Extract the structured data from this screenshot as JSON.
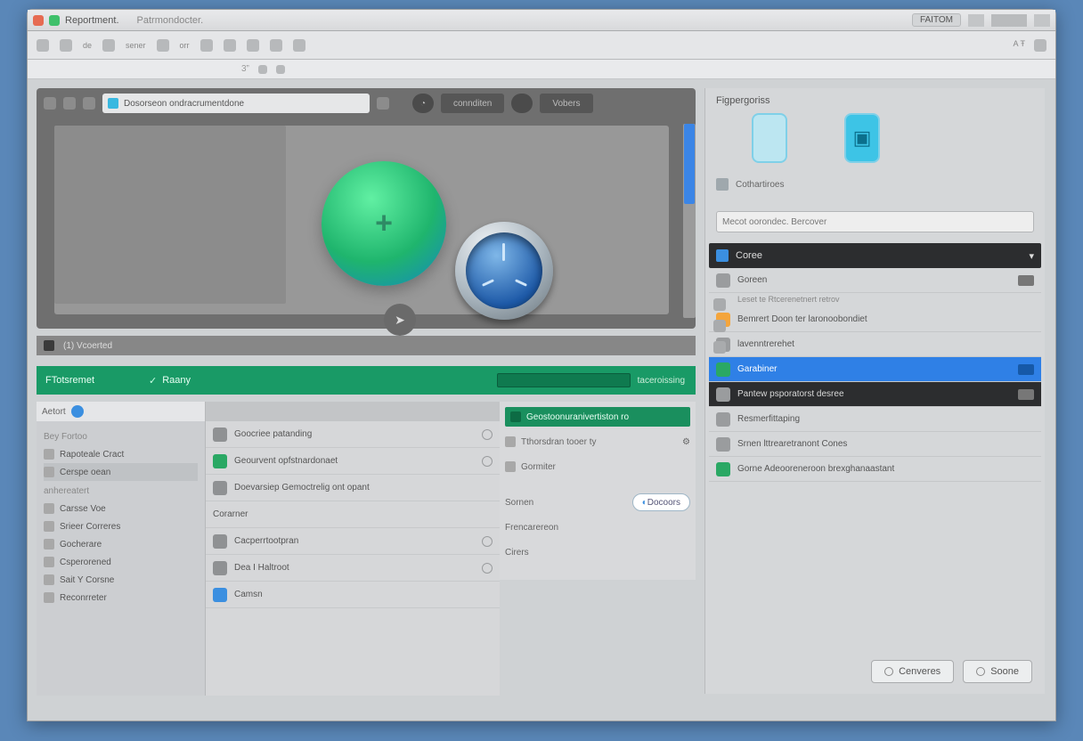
{
  "titlebar": {
    "title": "Reportment.",
    "subtitle": "Patrmondocter.",
    "badge": "FAITOM"
  },
  "iconrow": {
    "labels": [
      "",
      "de",
      "sener",
      "orr",
      "",
      "",
      "",
      "",
      ""
    ],
    "right_label": "A Ŧ"
  },
  "canvas": {
    "url_text": "Dosorseon ondracrumentdone",
    "btn_connect": "connditen",
    "btn_vobers": "Vobers",
    "footer_text": "(1)  Vcoerted"
  },
  "greenbar": {
    "left": "FTotsremet",
    "btn": "Raany",
    "right_text": "taceroissing"
  },
  "lowerleft": {
    "tab": "Aetort",
    "sections": {
      "a_head": "Bey Fortoo",
      "a_items": [
        "Rapoteale Cract",
        "Cerspe oean"
      ],
      "b_head": "anhereatert",
      "b_items": [
        "Carsse Voe",
        "Srieer Correres",
        "Gocherare",
        "Csperorened",
        "Sait Y Corsne",
        "Reconrreter"
      ]
    }
  },
  "lowermid": {
    "rows": [
      "Goocriee patanding",
      "Geourvent opfstnardonaet",
      "Doevarsiep Gemoctrelig ont opant",
      "Corarner",
      "Cacperrtootpran",
      "Dea I Haltroot",
      "Camsn"
    ]
  },
  "lowerright": {
    "header": "Geostoonuranivertiston ro",
    "line1": "Tthorsdran tooer ty",
    "line2": "Gormiter",
    "l1": "Sornen",
    "l2": "Frencarereon",
    "l3": "Cirers",
    "pill": "Docoors"
  },
  "rightpanel": {
    "title": "Figpergoriss",
    "row_label": "Cothartiroes",
    "search_placeholder": "Mecot oorondec. Bercover",
    "dark_label": "Coree",
    "group_head": "Goreen",
    "group_sub": "Leset te Rtcerenetnert retrov",
    "items": [
      "Bemrert Doon ter laronoobondiet",
      "lavenntrerehet",
      "Garabiner",
      "Pantew psporatorst desree",
      "Resmerfittaping",
      "Srnen lttrearetranont Cones",
      "Gorne Adeooreneroon brexghanaastant"
    ],
    "btn_cancel": "Cenveres",
    "btn_ok": "Soone"
  }
}
